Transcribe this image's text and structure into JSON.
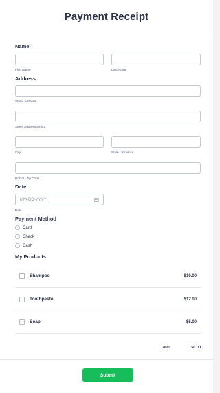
{
  "form": {
    "title": "Payment Receipt",
    "name_label": "Name",
    "first_name_sublabel": "First Name",
    "last_name_sublabel": "Last Name",
    "address_label": "Address",
    "street_sublabel": "Street Address",
    "street2_sublabel": "Street Address Line 2",
    "city_sublabel": "City",
    "state_sublabel": "State / Province",
    "postal_sublabel": "Postal / Zip Code",
    "date_label": "Date",
    "date_placeholder": "MM-DD-YYYY",
    "date_sublabel": "Date",
    "payment_label": "Payment Method",
    "payment_options": [
      "Card",
      "Check",
      "Cash"
    ],
    "products_label": "My Products",
    "products": [
      {
        "name": "Shampoo",
        "price": "$10.00"
      },
      {
        "name": "Toothpaste",
        "price": "$12.00"
      },
      {
        "name": "Soap",
        "price": "$5.00"
      }
    ],
    "total_label": "Total",
    "total_value": "$0.00",
    "submit_label": "Submit"
  },
  "colors": {
    "submit": "#18bd5b",
    "text": "#2c3345",
    "border": "#c3cad8"
  }
}
